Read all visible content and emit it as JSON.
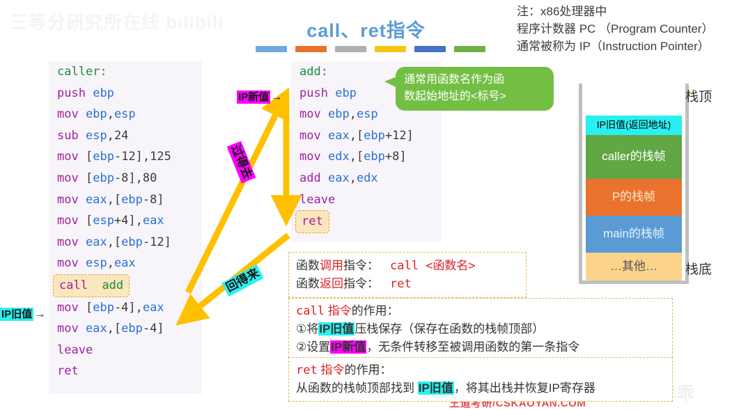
{
  "watermarks": {
    "top_left": "三等分研究所在线 bilibili",
    "csdn": "CSDN @狗狗狗乖乖",
    "footer": "王道考研/CSKAOYAN.COM"
  },
  "title": "call、ret指令",
  "title_rule_colors": [
    "#6fa8dc",
    "#e8722e",
    "#b0b0b0",
    "#f5c518",
    "#4472c4",
    "#70ad47"
  ],
  "note": {
    "line1": "注：x86处理器中",
    "line2": "程序计数器 PC （Program Counter）",
    "line3": "通常被称为 IP（Instruction Pointer）"
  },
  "caller_code": {
    "label": "caller:",
    "lines": [
      {
        "op": "push",
        "args": [
          {
            "t": "reg",
            "v": "ebp"
          }
        ]
      },
      {
        "op": "mov",
        "args": [
          {
            "t": "reg",
            "v": "ebp"
          },
          {
            "t": "pun",
            "v": ","
          },
          {
            "t": "reg",
            "v": "esp"
          }
        ]
      },
      {
        "op": "sub",
        "args": [
          {
            "t": "reg",
            "v": "esp"
          },
          {
            "t": "pun",
            "v": ","
          },
          {
            "t": "num",
            "v": "24"
          }
        ]
      },
      {
        "op": "mov",
        "args": [
          {
            "t": "pun",
            "v": "["
          },
          {
            "t": "reg",
            "v": "ebp"
          },
          {
            "t": "num",
            "v": "-12"
          },
          {
            "t": "pun",
            "v": "],"
          },
          {
            "t": "num",
            "v": "125"
          }
        ]
      },
      {
        "op": "mov",
        "args": [
          {
            "t": "pun",
            "v": "["
          },
          {
            "t": "reg",
            "v": "ebp"
          },
          {
            "t": "num",
            "v": "-8"
          },
          {
            "t": "pun",
            "v": "],"
          },
          {
            "t": "num",
            "v": "80"
          }
        ]
      },
      {
        "op": "mov",
        "args": [
          {
            "t": "reg",
            "v": "eax"
          },
          {
            "t": "pun",
            "v": ",["
          },
          {
            "t": "reg",
            "v": "ebp"
          },
          {
            "t": "num",
            "v": "-8"
          },
          {
            "t": "pun",
            "v": "]"
          }
        ]
      },
      {
        "op": "mov",
        "args": [
          {
            "t": "pun",
            "v": "["
          },
          {
            "t": "reg",
            "v": "esp"
          },
          {
            "t": "num",
            "v": "+4"
          },
          {
            "t": "pun",
            "v": "],"
          },
          {
            "t": "reg",
            "v": "eax"
          }
        ]
      },
      {
        "op": "mov",
        "args": [
          {
            "t": "reg",
            "v": "eax"
          },
          {
            "t": "pun",
            "v": ",["
          },
          {
            "t": "reg",
            "v": "ebp"
          },
          {
            "t": "num",
            "v": "-12"
          },
          {
            "t": "pun",
            "v": "]"
          }
        ]
      },
      {
        "op": "mov",
        "args": [
          {
            "t": "reg",
            "v": "esp"
          },
          {
            "t": "pun",
            "v": ","
          },
          {
            "t": "reg",
            "v": "eax"
          }
        ]
      }
    ],
    "highlight_call": {
      "op": "call",
      "target": "add"
    },
    "lines_after": [
      {
        "op": "mov",
        "args": [
          {
            "t": "pun",
            "v": "["
          },
          {
            "t": "reg",
            "v": "ebp"
          },
          {
            "t": "num",
            "v": "-4"
          },
          {
            "t": "pun",
            "v": "],"
          },
          {
            "t": "reg",
            "v": "eax"
          }
        ]
      },
      {
        "op": "mov",
        "args": [
          {
            "t": "reg",
            "v": "eax"
          },
          {
            "t": "pun",
            "v": ",["
          },
          {
            "t": "reg",
            "v": "ebp"
          },
          {
            "t": "num",
            "v": "-4"
          },
          {
            "t": "pun",
            "v": "]"
          }
        ]
      },
      {
        "op": "leave",
        "args": []
      },
      {
        "op": "ret",
        "args": []
      }
    ]
  },
  "add_code": {
    "label": "add:",
    "lines": [
      {
        "op": "push",
        "args": [
          {
            "t": "reg",
            "v": "ebp"
          }
        ]
      },
      {
        "op": "mov",
        "args": [
          {
            "t": "reg",
            "v": "ebp"
          },
          {
            "t": "pun",
            "v": ","
          },
          {
            "t": "reg",
            "v": "esp"
          }
        ]
      },
      {
        "op": "mov",
        "args": [
          {
            "t": "reg",
            "v": "eax"
          },
          {
            "t": "pun",
            "v": ",["
          },
          {
            "t": "reg",
            "v": "ebp"
          },
          {
            "t": "num",
            "v": "+12"
          },
          {
            "t": "pun",
            "v": "]"
          }
        ]
      },
      {
        "op": "mov",
        "args": [
          {
            "t": "reg",
            "v": "edx"
          },
          {
            "t": "pun",
            "v": ",["
          },
          {
            "t": "reg",
            "v": "ebp"
          },
          {
            "t": "num",
            "v": "+8"
          },
          {
            "t": "pun",
            "v": "]"
          }
        ]
      },
      {
        "op": "add",
        "args": [
          {
            "t": "reg",
            "v": "eax"
          },
          {
            "t": "pun",
            "v": ","
          },
          {
            "t": "reg",
            "v": "edx"
          }
        ]
      },
      {
        "op": "leave",
        "args": []
      }
    ],
    "highlight_ret": "ret"
  },
  "callout": {
    "line1": "通常用函数名作为函",
    "line2": "数起始地址的<标号>",
    "color": "#73bf44"
  },
  "arrow_labels": {
    "ip_new_prefix": "IP",
    "ip_new_body": "新值",
    "ip_old_prefix": "IP",
    "ip_old_body": "旧值",
    "arrow_glyph": "→",
    "go": "过得去",
    "back": "回得来"
  },
  "stack": {
    "top_label": "栈顶",
    "bottom_label": "栈底",
    "cells": [
      {
        "label": "IP旧值(返回地址)",
        "color": "#29f0f0",
        "text_color": "#000000",
        "height": 28,
        "font_size": 14
      },
      {
        "label": "caller的栈帧",
        "color": "#61a744",
        "text_color": "#ffffff",
        "height": 63,
        "font_size": 17
      },
      {
        "label": "P的栈帧",
        "color": "#e8722e",
        "text_color": "#ffe9c8",
        "height": 53,
        "font_size": 17
      },
      {
        "label": "main的栈帧",
        "color": "#5b9bd5",
        "text_color": "#eaf3fb",
        "height": 53,
        "font_size": 17
      },
      {
        "label": "…其他…",
        "color": "#fbd38a",
        "text_color": "#555555",
        "height": 40,
        "font_size": 17
      }
    ]
  },
  "box_instructions": {
    "row1_key_a": "函数",
    "row1_key_red": "调用",
    "row1_key_b": "指令：",
    "row1_val": "call <函数名>",
    "row2_key_a": "函数",
    "row2_key_red": "返回",
    "row2_key_b": "指令：",
    "row2_val": "ret"
  },
  "box_call": {
    "head_mono": "call",
    "head_red": "指令",
    "head_tail": "的作用：",
    "item1_a": "①将",
    "item1_hl": "IP旧值",
    "item1_b": "压栈保存（保存在函数的栈帧顶部）",
    "item2_a": "②设置",
    "item2_hl": "IP新值",
    "item2_b": "，无条件转移至被调用函数的第一条指令"
  },
  "box_ret": {
    "head_mono": "ret",
    "head_red": "指令",
    "head_tail": "的作用：",
    "line_a": "从函数的栈帧顶部找到 ",
    "line_hl": "IP旧值",
    "line_b": "，将其出栈并恢复IP寄存器"
  }
}
